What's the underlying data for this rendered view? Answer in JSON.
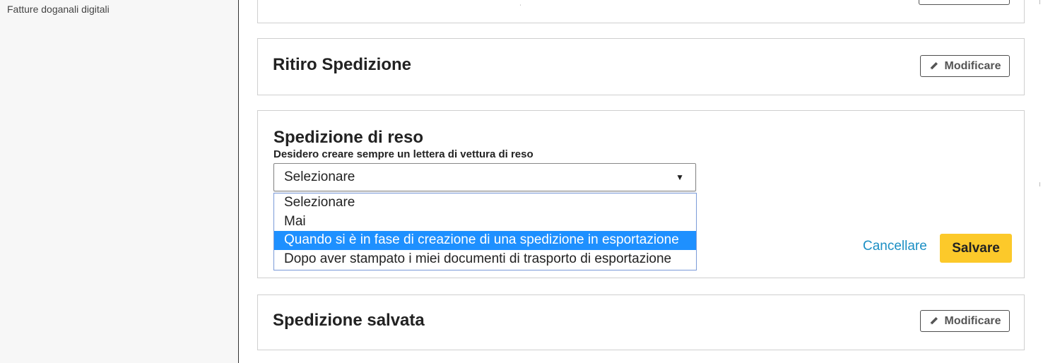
{
  "sidebar": {
    "link_label": "Fatture doganali digitali"
  },
  "sections": {
    "ritiro": {
      "title": "Ritiro Spedizione",
      "edit_label": "Modificare"
    },
    "reso": {
      "title": "Spedizione di reso",
      "field_label": "Desidero creare sempre un lettera di vettura di reso",
      "select": {
        "value": "Selezionare",
        "options": [
          "Selezionare",
          "Mai",
          "Quando si è in fase di creazione di una spedizione in esportazione",
          "Dopo aver stampato i miei documenti di trasporto di esportazione"
        ],
        "highlighted_index": 2
      },
      "cancel_label": "Cancellare",
      "save_label": "Salvare"
    },
    "salvata": {
      "title": "Spedizione salvata",
      "edit_label": "Modificare"
    }
  },
  "colors": {
    "accent_link": "#1c8fc4",
    "save_button": "#fcc92a",
    "highlight": "#1e90ff"
  },
  "icons": {
    "edit": "pencil-icon",
    "dropdown": "triangle-down-icon"
  }
}
